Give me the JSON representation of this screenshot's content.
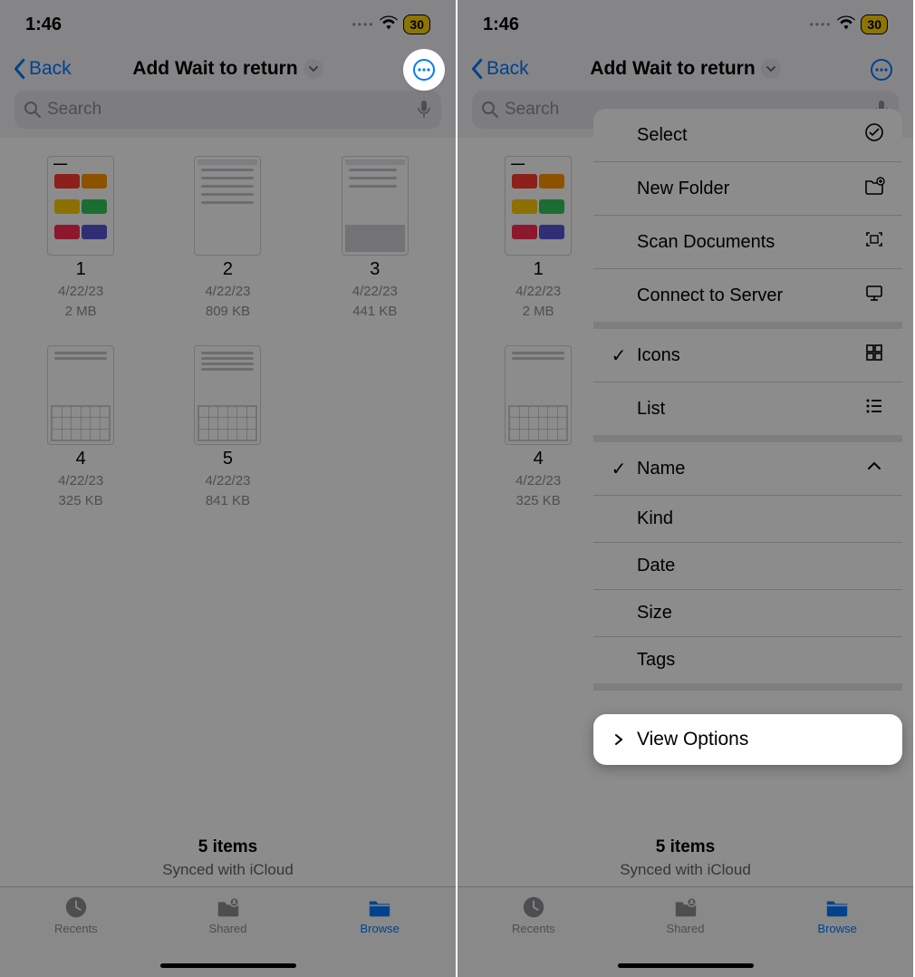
{
  "status": {
    "time": "1:46",
    "battery": "30"
  },
  "nav": {
    "back": "Back",
    "title": "Add Wait to return"
  },
  "search": {
    "placeholder": "Search"
  },
  "files": [
    {
      "name": "1",
      "date": "4/22/23",
      "size": "2 MB",
      "thumb": "palette"
    },
    {
      "name": "2",
      "date": "4/22/23",
      "size": "809 KB",
      "thumb": "lines"
    },
    {
      "name": "3",
      "date": "4/22/23",
      "size": "441 KB",
      "thumb": "form"
    },
    {
      "name": "4",
      "date": "4/22/23",
      "size": "325 KB",
      "thumb": "kb"
    },
    {
      "name": "5",
      "date": "4/22/23",
      "size": "841 KB",
      "thumb": "kb2"
    }
  ],
  "summary": {
    "count": "5 items",
    "sync": "Synced with iCloud"
  },
  "tabs": {
    "recents": "Recents",
    "shared": "Shared",
    "browse": "Browse"
  },
  "menu": {
    "group1": {
      "select": "Select",
      "new_folder": "New Folder",
      "scan": "Scan Documents",
      "connect": "Connect to Server"
    },
    "group2": {
      "icons": "Icons",
      "list": "List"
    },
    "group3": {
      "name": "Name",
      "kind": "Kind",
      "date": "Date",
      "size": "Size",
      "tags": "Tags"
    },
    "group4": {
      "view_options": "View Options"
    }
  }
}
